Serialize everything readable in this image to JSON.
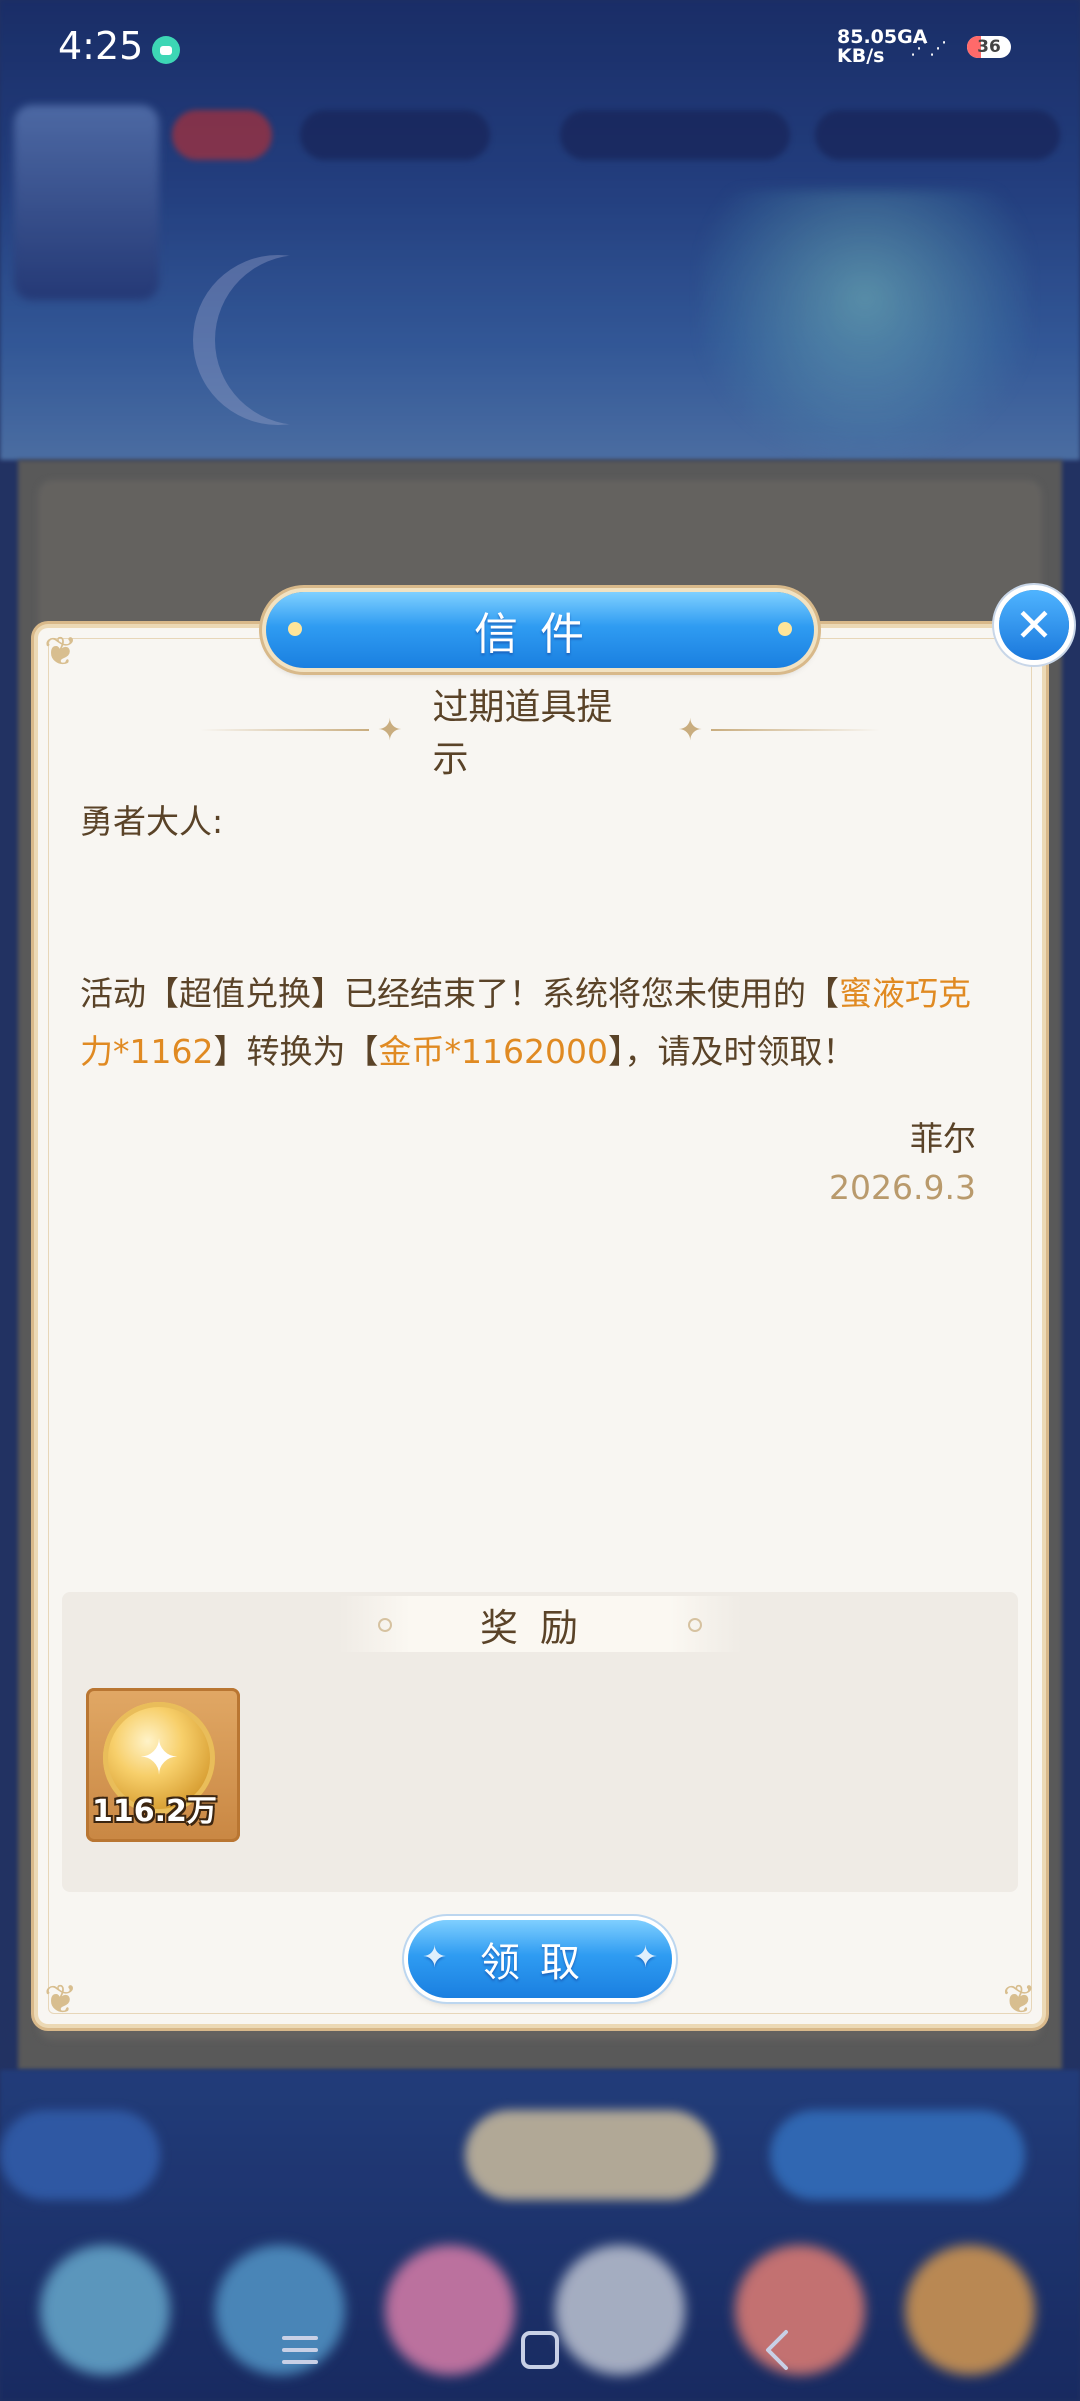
{
  "status_bar": {
    "time": "4:25",
    "net_speed_value": "85.0",
    "net_speed_unit": "KB/s",
    "network": "5GA",
    "battery": "36"
  },
  "modal": {
    "title": "信件",
    "subtitle": "过期道具提示",
    "greeting": "勇者大人:",
    "body": {
      "p1": "活动【超值兑换】已经结束了！系统将您未使用的【",
      "item_from": "蜜液巧克力*1162",
      "p2": "】转换为【",
      "item_to": "金币*1162000",
      "p3": "】，请及时领取！"
    },
    "signature": "菲尔",
    "date": "2026.9.3",
    "reward_label": "奖励",
    "rewards": [
      {
        "icon": "gold-coin-icon",
        "count": "116.2万"
      }
    ],
    "claim_button": "领取",
    "close_icon": "close-icon"
  },
  "colors": {
    "accent_blue": "#2f9cf2",
    "highlight_orange": "#e08a22",
    "text_brown": "#5a4328",
    "date_tan": "#b99a6c"
  }
}
